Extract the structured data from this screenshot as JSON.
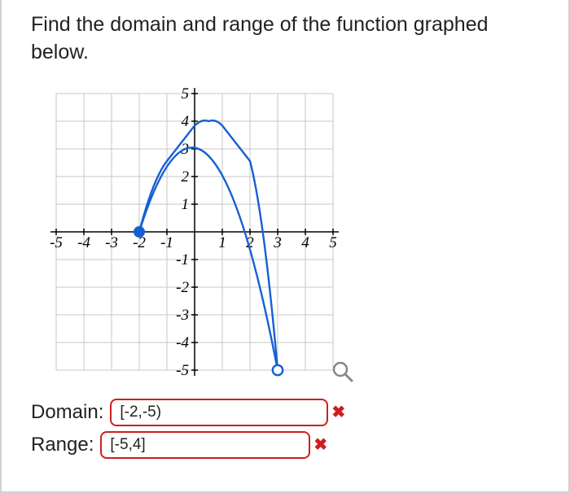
{
  "question_text": "Find the domain and range of the function graphed below.",
  "chart_data": {
    "type": "line",
    "title": "",
    "xlabel": "",
    "ylabel": "",
    "xlim": [
      -5,
      5
    ],
    "ylim": [
      -5,
      5
    ],
    "x_ticks": [
      -5,
      -4,
      -3,
      -2,
      -1,
      1,
      2,
      3,
      4,
      5
    ],
    "y_ticks": [
      -5,
      -4,
      -3,
      -2,
      -1,
      1,
      2,
      3,
      4,
      5
    ],
    "grid": true,
    "curve": {
      "type": "parabola",
      "vertex": {
        "x": 0.5,
        "y": 4
      },
      "points": [
        {
          "x": -2,
          "y": 0,
          "endpoint": "closed"
        },
        {
          "x": -1,
          "y": 2.56
        },
        {
          "x": 0,
          "y": 3.84
        },
        {
          "x": 0.5,
          "y": 4
        },
        {
          "x": 1,
          "y": 3.84
        },
        {
          "x": 2,
          "y": 2.56
        },
        {
          "x": 3,
          "y": -5,
          "endpoint": "open"
        }
      ],
      "color": "#1560d4"
    }
  },
  "answers": {
    "domain": {
      "label": "Domain:",
      "value": "[-2,-5)",
      "correct": false
    },
    "range": {
      "label": "Range:",
      "value": "[-5,4]",
      "correct": false
    }
  },
  "icons": {
    "wrong": "✖",
    "magnifier": "magnifier-icon"
  }
}
